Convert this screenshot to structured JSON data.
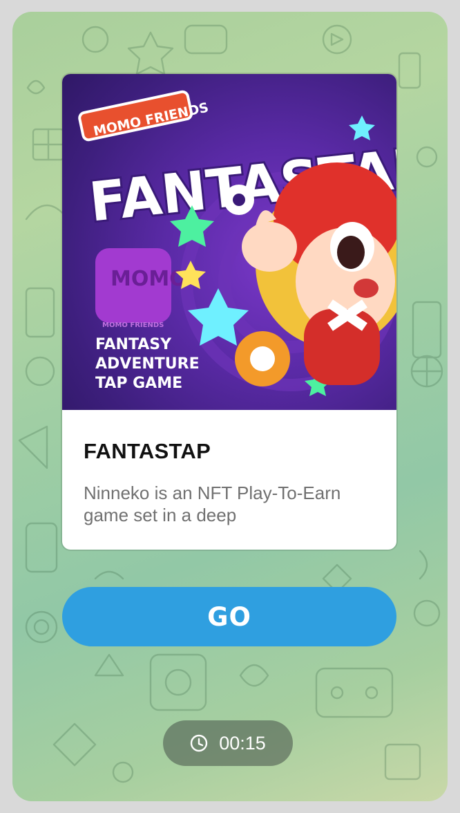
{
  "card": {
    "image_alt": "MOMO FRIENDS FANTASTAP FANTASY ADVENTURE TAP GAME",
    "banner": {
      "badge": "MOMO FRIENDS",
      "logo": "FANTASTAP",
      "brand_mark": "MOMO",
      "brand_sub": "MOMO FRIENDS",
      "tagline_1": "FANTASY",
      "tagline_2": "ADVENTURE",
      "tagline_3": "TAP GAME"
    },
    "title": "FANTASTAP",
    "description": "Ninneko is an NFT Play-To-Earn game set in a deep"
  },
  "actions": {
    "go_label": "GO"
  },
  "timer": {
    "icon": "clock-icon",
    "value": "00:15"
  },
  "colors": {
    "button": "#2f9fe0",
    "banner": "#5a2aa6",
    "background": "#9fcea4"
  }
}
